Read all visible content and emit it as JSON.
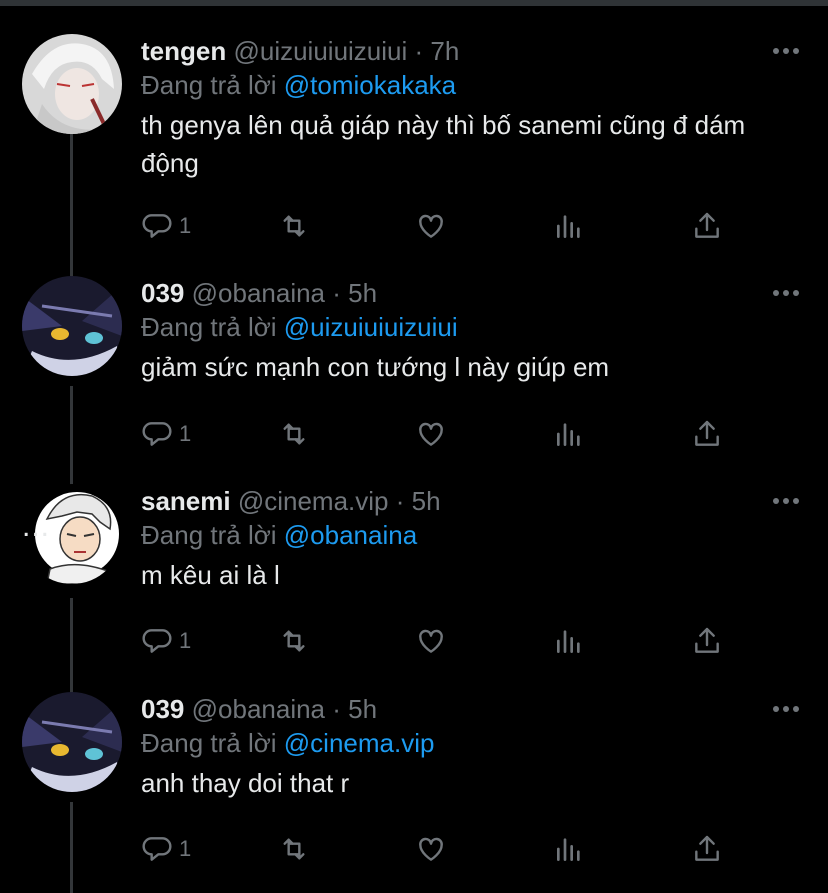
{
  "tweets": [
    {
      "name": "tengen",
      "handle": "@uizuiuiuizuiui",
      "dot": "·",
      "time": "7h",
      "reply_prefix": "Đang trả lời ",
      "reply_to": "@tomiokakaka",
      "text": "th genya lên quả giáp này thì bố sanemi cũng đ dám động",
      "reply_count": "1"
    },
    {
      "name": "039",
      "handle": "@obanaina",
      "dot": "·",
      "time": "5h",
      "reply_prefix": "Đang trả lời ",
      "reply_to": "@uizuiuiuizuiui",
      "text": "giảm sức mạnh con tướng l này giúp em",
      "reply_count": "1"
    },
    {
      "name": "sanemi",
      "handle": "@cinema.vip",
      "dot": "·",
      "time": "5h",
      "reply_prefix": "Đang trả lời ",
      "reply_to": "@obanaina",
      "text": "m kêu ai là l",
      "reply_count": "1",
      "avatar_ellipsis": "..."
    },
    {
      "name": "039",
      "handle": "@obanaina",
      "dot": "·",
      "time": "5h",
      "reply_prefix": "Đang trả lời ",
      "reply_to": "@cinema.vip",
      "text": "anh thay doi that r",
      "reply_count": "1"
    }
  ],
  "icons": {
    "reply": "reply-icon",
    "retweet": "retweet-icon",
    "like": "heart-icon",
    "views": "views-icon",
    "share": "share-icon",
    "more": "more-icon"
  },
  "colors": {
    "background": "#000000",
    "text": "#e7e9ea",
    "muted": "#71767b",
    "link": "#1d9bf0",
    "thread_line": "#333639"
  }
}
